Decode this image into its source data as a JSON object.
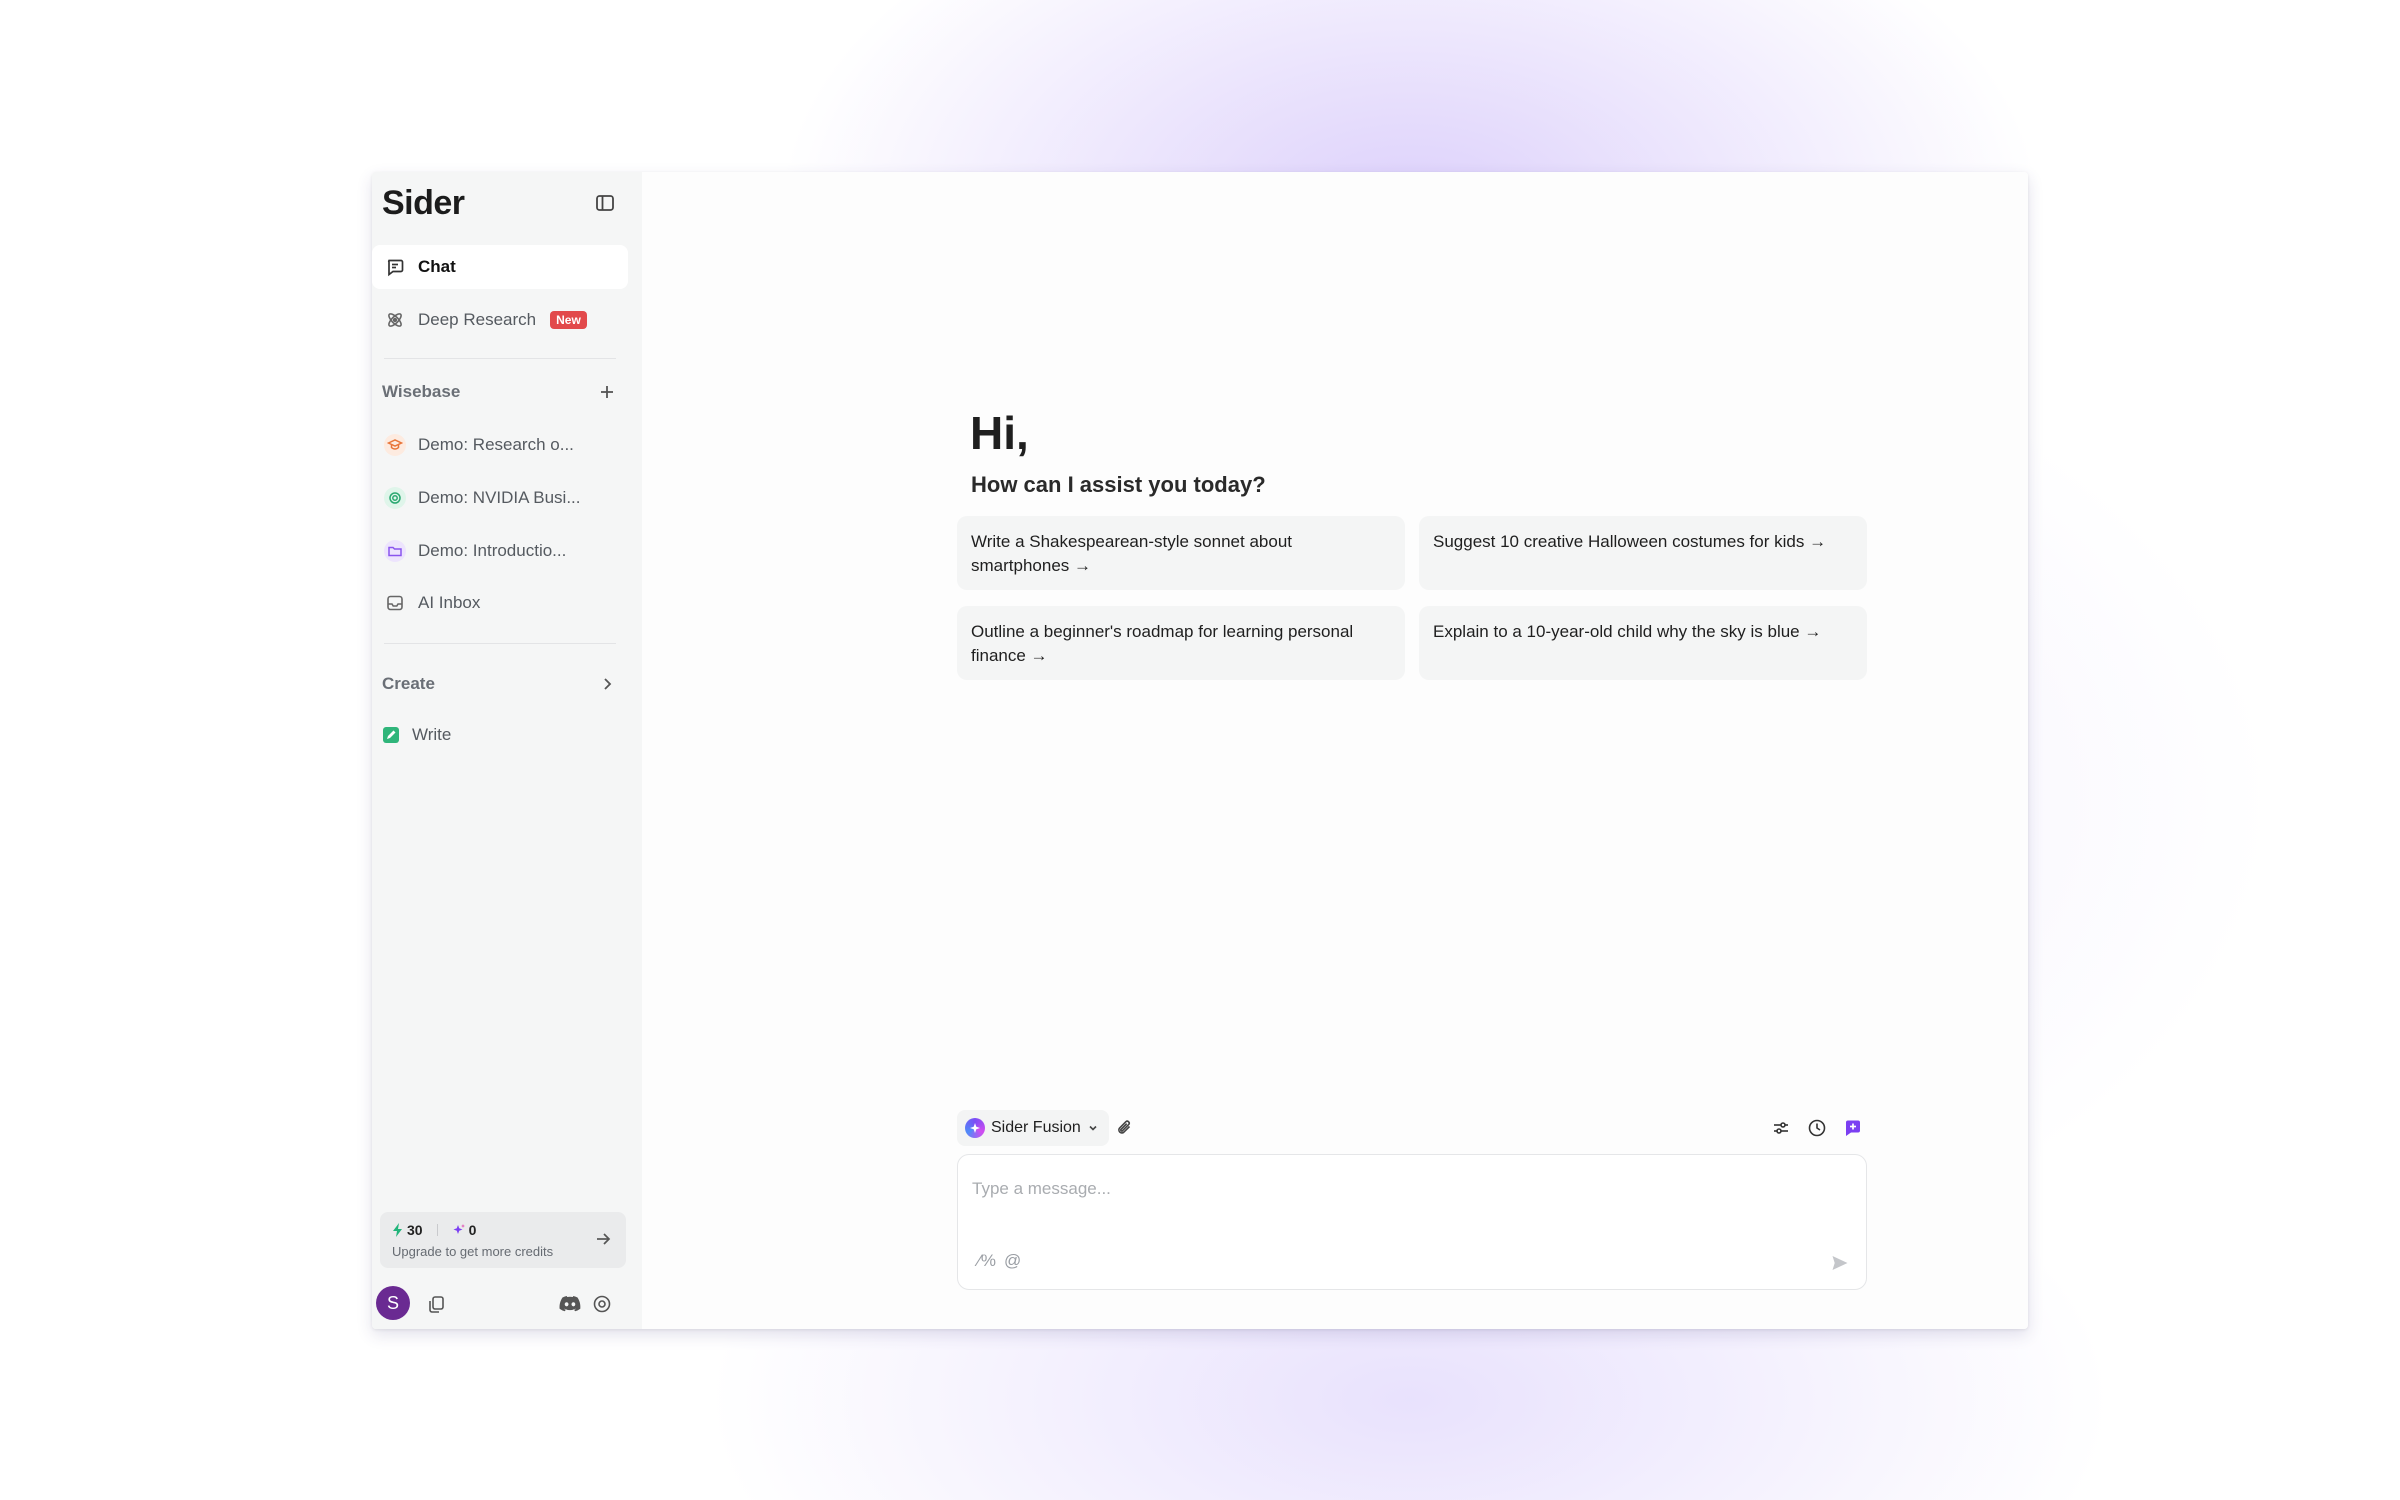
{
  "sidebar": {
    "brand": "Sider",
    "nav": [
      {
        "label": "Chat",
        "icon": "chat-icon"
      },
      {
        "label": "Deep Research",
        "icon": "atom-icon",
        "badge": "New"
      }
    ],
    "wisebase": {
      "title": "Wisebase",
      "items": [
        {
          "label": "Demo: Research o...",
          "icon": "graduation-cap-icon"
        },
        {
          "label": "Demo: NVIDIA Busi...",
          "icon": "chip-icon"
        },
        {
          "label": "Demo: Introductio...",
          "icon": "folder-icon"
        },
        {
          "label": "AI Inbox",
          "icon": "inbox-icon"
        }
      ]
    },
    "create": {
      "title": "Create",
      "items": [
        {
          "label": "Write",
          "icon": "write-icon"
        }
      ]
    },
    "credits": {
      "basic": "30",
      "advanced": "0",
      "note": "Upgrade to get more credits"
    },
    "avatar_initial": "S"
  },
  "main": {
    "greeting": "Hi,",
    "subtitle": "How can I assist you today?",
    "suggestions": [
      "Write a Shakespearean-style sonnet about smartphones →",
      "Suggest 10 creative Halloween costumes for kids →",
      "Outline a beginner's roadmap for learning personal finance →",
      "Explain to a 10-year-old child why the sky is blue →"
    ],
    "composer": {
      "model": "Sider Fusion",
      "placeholder": "Type a message...",
      "prompt_shortcut": "⁄%",
      "mention_shortcut": "@"
    }
  },
  "colors": {
    "accent": "#7b3ff2",
    "new_badge": "#e2494b",
    "avatar": "#6a2a92",
    "sidebar_bg": "#f5f6f6"
  }
}
